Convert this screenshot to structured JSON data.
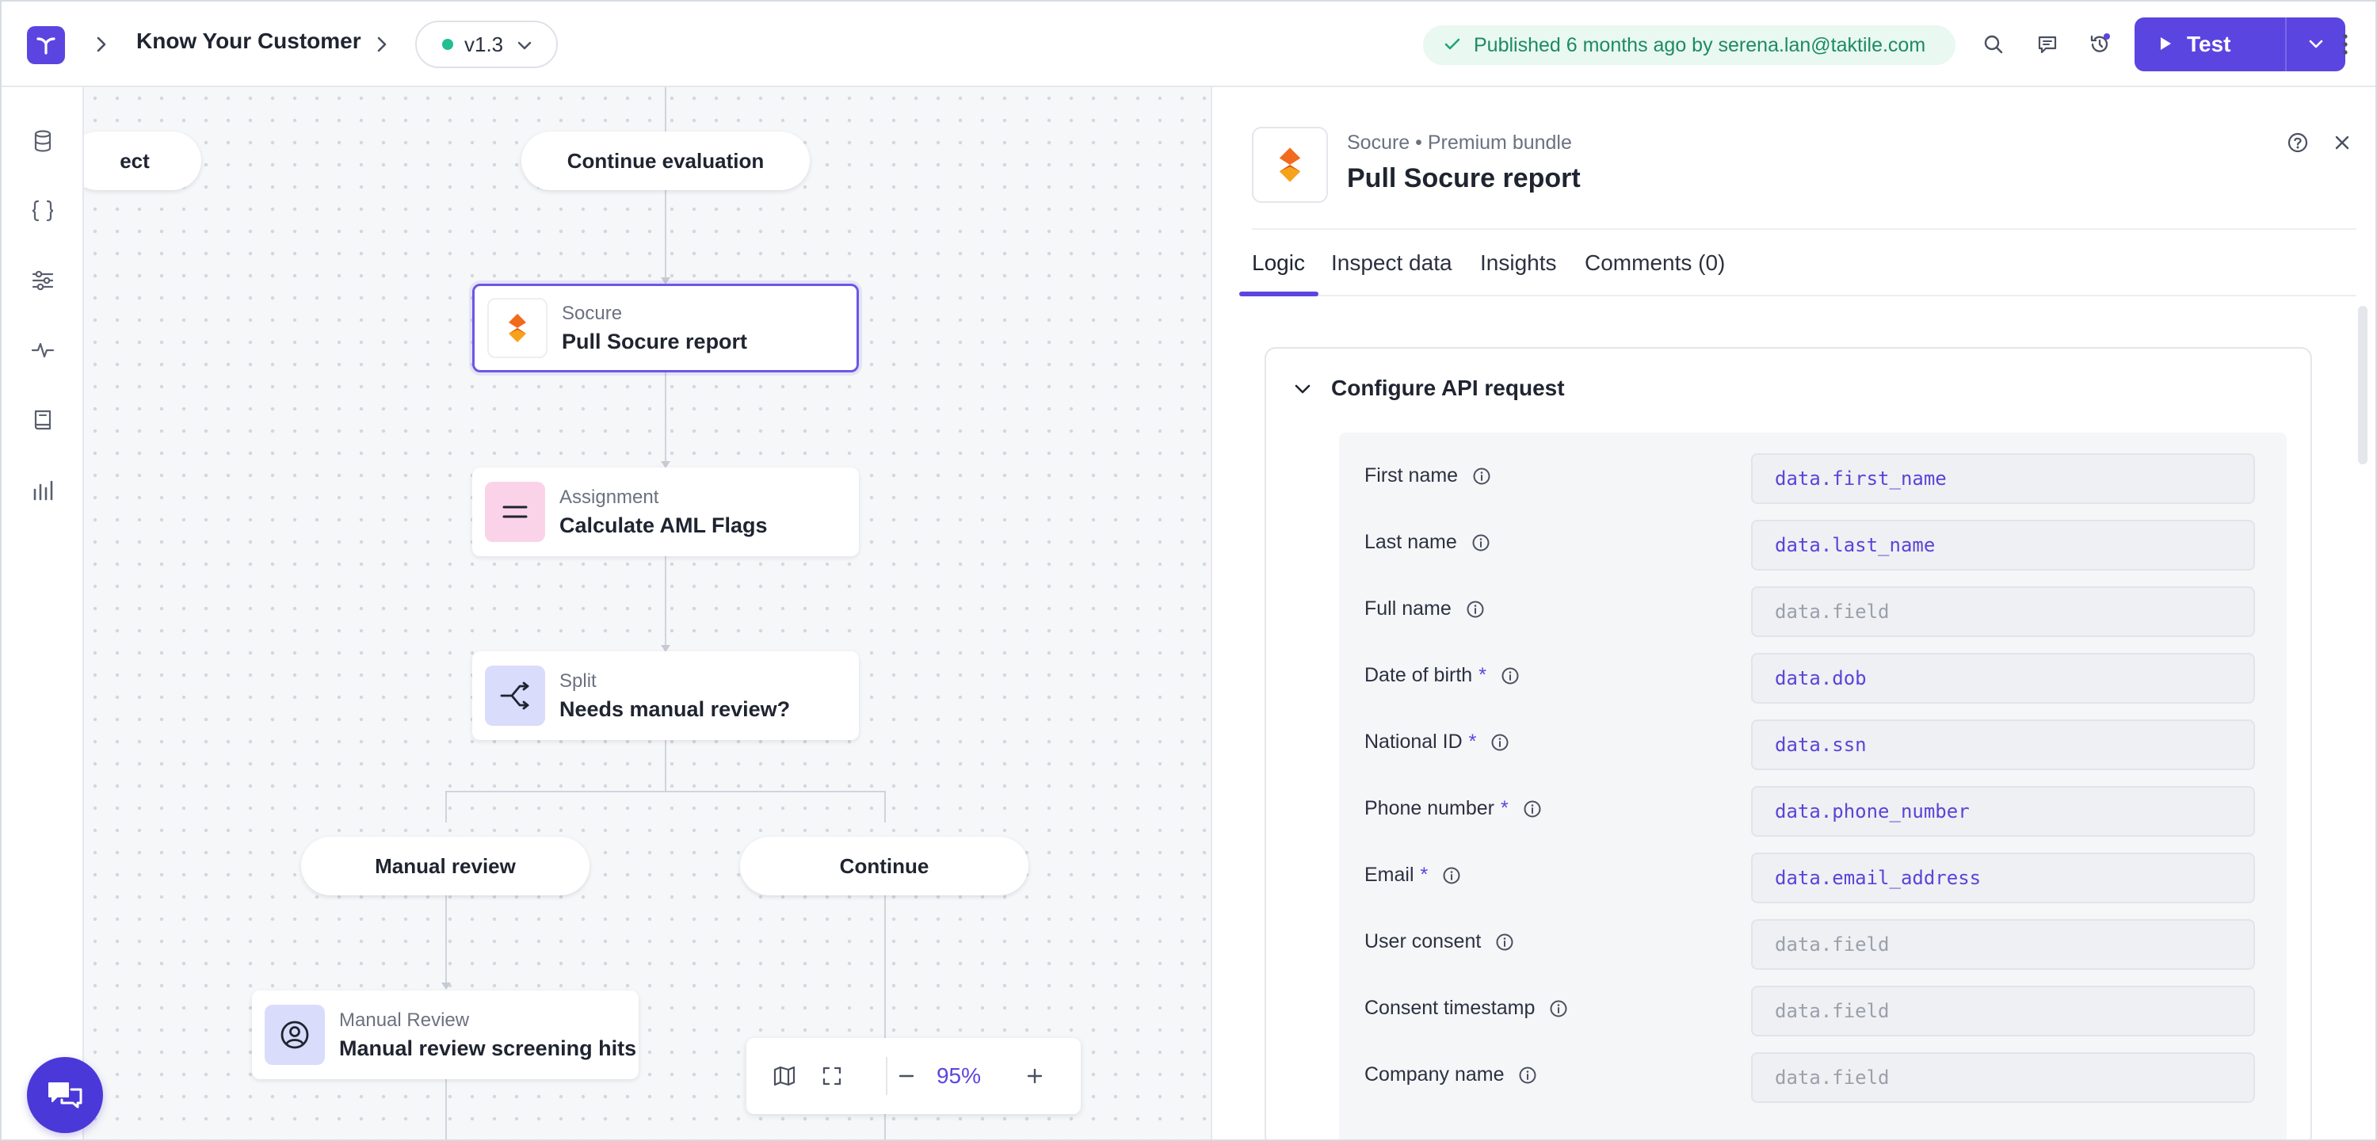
{
  "topbar": {
    "title": "Know Your Customer",
    "version": "v1.3",
    "published": "Published 6 months ago by serena.lan@taktile.com",
    "test_label": "Test"
  },
  "canvas": {
    "pills": {
      "reject_partial": "ect",
      "continue_evaluation": "Continue evaluation",
      "manual_review": "Manual review",
      "continue": "Continue"
    },
    "nodes": [
      {
        "type": "Socure",
        "name": "Pull Socure report"
      },
      {
        "type": "Assignment",
        "name": "Calculate AML Flags"
      },
      {
        "type": "Split",
        "name": "Needs manual review?"
      },
      {
        "type": "Manual Review",
        "name": "Manual review screening hits"
      }
    ],
    "zoom": "95%"
  },
  "panel": {
    "subtitle": "Socure • Premium bundle",
    "title": "Pull Socure report",
    "tabs": [
      "Logic",
      "Inspect data",
      "Insights",
      "Comments (0)"
    ],
    "active_tab": "Logic",
    "section_title": "Configure API request",
    "fields": [
      {
        "label": "First name",
        "value": "data.first_name"
      },
      {
        "label": "Last name",
        "value": "data.last_name"
      },
      {
        "label": "Full name",
        "placeholder": "data.field"
      },
      {
        "label": "Date of birth",
        "required": "*",
        "value": "data.dob"
      },
      {
        "label": "National ID",
        "required": "*",
        "value": "data.ssn"
      },
      {
        "label": "Phone number",
        "required": "*",
        "value": "data.phone_number"
      },
      {
        "label": "Email",
        "required": "*",
        "value": "data.email_address"
      },
      {
        "label": "User consent",
        "placeholder": "data.field"
      },
      {
        "label": "Consent timestamp",
        "placeholder": "data.field"
      },
      {
        "label": "Company name",
        "placeholder": "data.field"
      }
    ]
  },
  "colors": {
    "accent": "#5b45e0",
    "published_bg": "#e9f8f1",
    "published_text": "#1d8a64",
    "socure_orange": "#f26a1b",
    "assignment_bg": "#fbd3e9",
    "split_bg": "#d9dcfb"
  },
  "icons": {
    "rail": [
      "database-icon",
      "braces-icon",
      "sliders-icon",
      "activity-icon",
      "book-icon",
      "bar-chart-icon"
    ],
    "topbar": [
      "search-icon",
      "comment-icon",
      "history-icon",
      "more-vertical-icon"
    ]
  }
}
